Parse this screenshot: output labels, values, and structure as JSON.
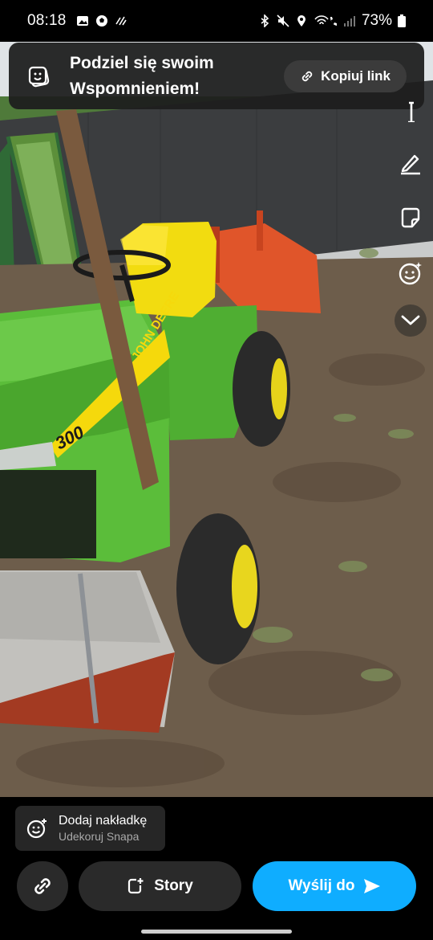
{
  "status_bar": {
    "time": "08:18",
    "battery": "73%",
    "left_icons": [
      "gallery-icon",
      "soccer-ball-icon",
      "data-saver-icon"
    ],
    "right_icons": [
      "bluetooth-icon",
      "mute-icon",
      "location-icon",
      "wifi-call-icon",
      "signal-icon",
      "battery-icon"
    ]
  },
  "banner": {
    "title": "Podziel się swoim Wspomnieniem!",
    "copy_link": "Kopiuj link",
    "icon": "memories-icon"
  },
  "photo": {
    "subject": "tractor-photo",
    "hood_text": "JOHN DEERE",
    "model_badge": "300"
  },
  "tools": [
    "text-icon",
    "pencil-icon",
    "sticker-icon",
    "emoji-sparkle-icon",
    "chevron-down-icon"
  ],
  "bottom": {
    "overlay_title": "Dodaj nakładkę",
    "overlay_subtitle": "Udekoruj Snapa",
    "story_label": "Story",
    "send_label": "Wyślij do"
  },
  "colors": {
    "send_button": "#0fadff",
    "tractor_green": "#5bbd3a",
    "tractor_yellow": "#f5d90c",
    "tiller_orange": "#e0552a"
  }
}
